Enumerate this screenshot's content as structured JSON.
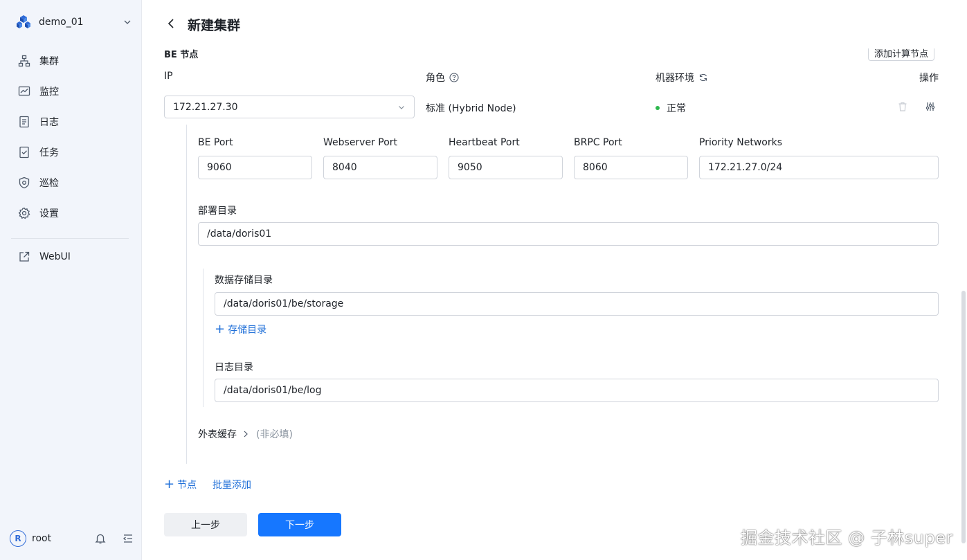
{
  "sidebar": {
    "cluster_name": "demo_01",
    "items": [
      {
        "label": "集群",
        "icon": "cluster-icon"
      },
      {
        "label": "监控",
        "icon": "monitor-icon"
      },
      {
        "label": "日志",
        "icon": "log-icon"
      },
      {
        "label": "任务",
        "icon": "task-icon"
      },
      {
        "label": "巡检",
        "icon": "inspect-icon"
      },
      {
        "label": "设置",
        "icon": "gear-icon"
      }
    ],
    "webui_label": "WebUI",
    "user": {
      "initial": "R",
      "name": "root"
    }
  },
  "header": {
    "title": "新建集群"
  },
  "be_section": {
    "title": "BE 节点",
    "add_compute_label": "添加计算节点",
    "columns": {
      "ip": "IP",
      "role": "角色",
      "env": "机器环境",
      "action": "操作"
    },
    "node": {
      "ip": "172.21.27.30",
      "role": "标准 (Hybrid Node)",
      "env_status": "正常",
      "status_color": "#2db84d"
    },
    "ports": [
      {
        "label": "BE Port",
        "value": "9060"
      },
      {
        "label": "Webserver Port",
        "value": "8040"
      },
      {
        "label": "Heartbeat Port",
        "value": "9050"
      },
      {
        "label": "BRPC Port",
        "value": "8060"
      },
      {
        "label": "Priority Networks",
        "value": "172.21.27.0/24"
      }
    ],
    "deploy_dir": {
      "label": "部署目录",
      "value": "/data/doris01"
    },
    "storage_dir": {
      "label": "数据存储目录",
      "value": "/data/doris01/be/storage",
      "add_label": "存储目录"
    },
    "log_dir": {
      "label": "日志目录",
      "value": "/data/doris01/be/log"
    },
    "external_cache": {
      "label": "外表缓存",
      "optional": "(非必填)"
    },
    "add_node_label": "节点",
    "batch_add_label": "批量添加"
  },
  "footer": {
    "prev_label": "上一步",
    "next_label": "下一步"
  },
  "watermark": "掘金技术社区 @ 子林super",
  "colors": {
    "primary": "#1677ff",
    "link": "#1f6fd8",
    "sidebar_bg": "#f2f5fb"
  }
}
